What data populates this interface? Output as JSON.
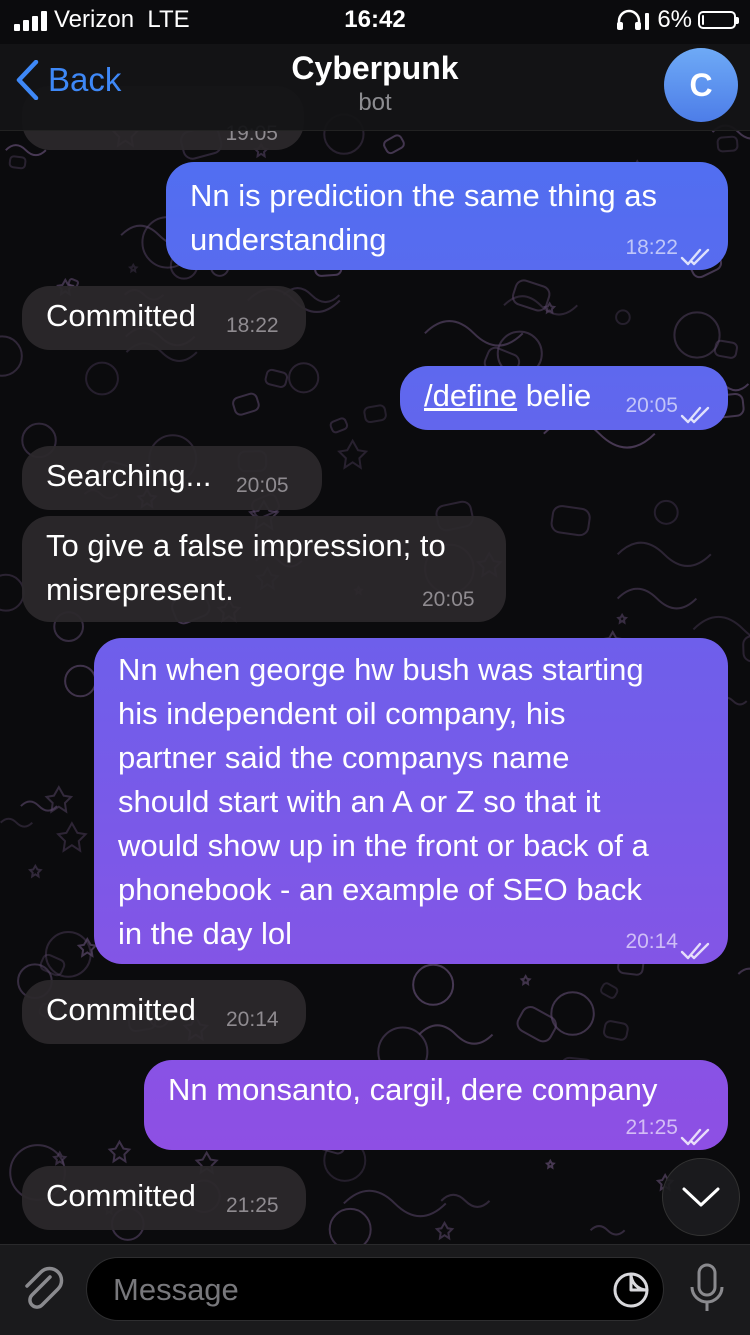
{
  "status_bar": {
    "carrier": "Verizon",
    "network": "LTE",
    "time": "16:42",
    "battery": "6%",
    "battery_level": 0.06
  },
  "nav": {
    "back_label": "Back",
    "title": "Cyberpunk",
    "subtitle": "bot",
    "avatar_letter": "C"
  },
  "partial_time": "19:05",
  "messages": [
    {
      "direction": "out",
      "text": [
        "Nn is prediction the same thing as",
        "understanding"
      ],
      "time": "18:22",
      "status": "read"
    },
    {
      "direction": "in",
      "text": [
        "Committed"
      ],
      "time": "18:22"
    },
    {
      "direction": "out",
      "command": "/define",
      "text": [
        "belie"
      ],
      "time": "20:05",
      "status": "read"
    },
    {
      "direction": "in",
      "text": [
        "Searching..."
      ],
      "time": "20:05"
    },
    {
      "direction": "in",
      "text": [
        "To give a false impression; to",
        "misrepresent."
      ],
      "time": "20:05"
    },
    {
      "direction": "out",
      "text": [
        "Nn when george hw bush was starting",
        "his independent oil company, his",
        "partner said the companys name",
        "should start with an A or Z so that it",
        "would show up in the front or back of a",
        "phonebook - an example of SEO back",
        "in the day lol"
      ],
      "time": "20:14",
      "status": "read"
    },
    {
      "direction": "in",
      "text": [
        "Committed"
      ],
      "time": "20:14"
    },
    {
      "direction": "out",
      "text": [
        "Nn monsanto, cargil, dere company"
      ],
      "time": "21:25",
      "status": "read"
    },
    {
      "direction": "in",
      "text": [
        "Committed"
      ],
      "time": "21:25"
    }
  ],
  "input": {
    "placeholder": "Message"
  },
  "icons": {
    "back": "chevron-left-icon",
    "attach": "paperclip-icon",
    "sticker": "sticker-icon",
    "mic": "microphone-icon",
    "scroll": "chevron-down-icon",
    "read_status": "double-check-icon",
    "headphones": "headphones-icon"
  },
  "colors": {
    "accent": "#3e88f7",
    "bubble_in": "#2c282c",
    "bubble_out_top": "#4f6ff1",
    "bubble_out_bottom": "#8e4fe4",
    "wallpaper_line": "#574566"
  }
}
